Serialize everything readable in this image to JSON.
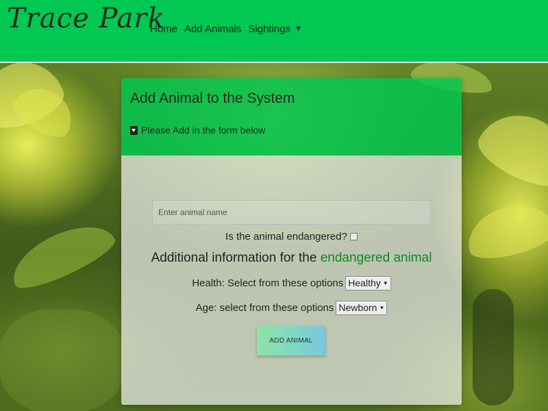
{
  "navbar": {
    "brand": "Trace Park",
    "links": {
      "home": "Home",
      "add_animals": "Add Animals",
      "sightings": "Sightings"
    }
  },
  "card": {
    "title": "Add Animal to the System",
    "subtitle": "Please Add in the form below",
    "subtitle_icon": "caret-square-down-icon"
  },
  "form": {
    "name_placeholder": "Enter animal name",
    "name_value": "",
    "endangered_question": "Is the animal endangered?",
    "endangered_checked": false,
    "info_prefix": "Additional information for the",
    "info_accent": "endangered animal",
    "health_label": "Health: Select from these options",
    "health_selected": "Healthy",
    "age_label": "Age: select from these options",
    "age_selected": "Newborn",
    "submit_label": "ADD ANIMAL"
  },
  "colors": {
    "navbar": "#00c853",
    "card_header": "#00c850",
    "accent_text": "#0f8a1b"
  }
}
